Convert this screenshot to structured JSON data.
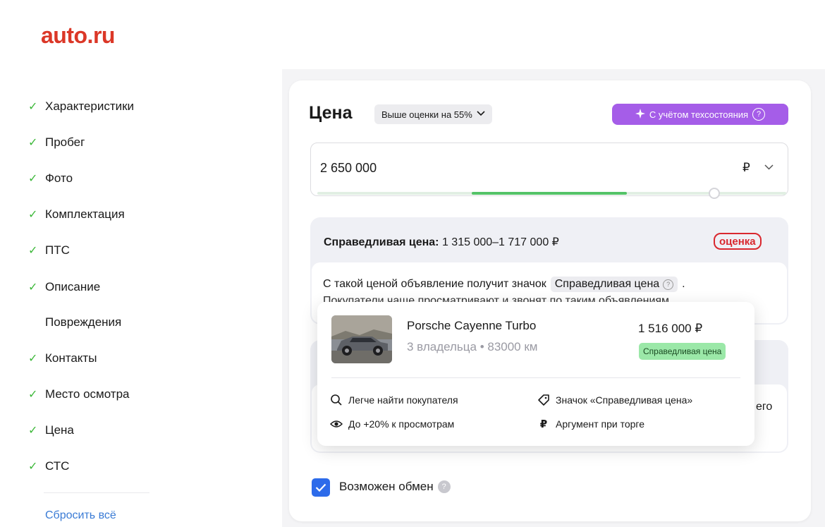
{
  "header": {
    "logo": "auto.ru"
  },
  "sidebar": {
    "items": [
      {
        "label": "Характеристики",
        "checked": true
      },
      {
        "label": "Пробег",
        "checked": true
      },
      {
        "label": "Фото",
        "checked": true
      },
      {
        "label": "Комплектация",
        "checked": true
      },
      {
        "label": "ПТС",
        "checked": true
      },
      {
        "label": "Описание",
        "checked": true
      },
      {
        "label": "Повреждения",
        "checked": false
      },
      {
        "label": "Контакты",
        "checked": true
      },
      {
        "label": "Место осмотра",
        "checked": true
      },
      {
        "label": "Цена",
        "checked": true
      },
      {
        "label": "СТС",
        "checked": true
      }
    ],
    "reset_label": "Сбросить всё"
  },
  "price": {
    "title": "Цена",
    "estimate_pill": "Выше оценки на 55%",
    "tech_button": "С учётом техсостояния",
    "value": "2 650 000",
    "currency": "₽",
    "slider_green_range": [
      0.33,
      0.66
    ],
    "slider_level": 0.84
  },
  "fair": {
    "title_bold": "Справедливая цена:",
    "title_range": "1 315 000–1 717 000 ₽",
    "ocenka_label": "оценка",
    "text_before": "С такой ценой объявление получит значок",
    "chip_label": "Справедливая цена",
    "text_after": ".",
    "text_line2": "Покупатели чаще просматривают и звонят по таким объявлениям"
  },
  "second": {
    "cut_text": "его"
  },
  "popup": {
    "car_name": "Porsche Cayenne Turbo",
    "car_meta": "3 владельца • 83000 км",
    "car_price": "1 516 000 ₽",
    "car_badge": "Справедливая цена",
    "benefits": [
      {
        "icon": "search-icon",
        "label": "Легче найти покупателя"
      },
      {
        "icon": "tag-icon",
        "label": "Значок «Справедливая цена»"
      },
      {
        "icon": "eye-icon",
        "label": "До +20% к просмотрам"
      },
      {
        "icon": "ruble-icon",
        "label": "Аргумент при торге"
      }
    ]
  },
  "exchange": {
    "label": "Возможен обмен",
    "checked": true
  },
  "colors": {
    "brand": "#db3727",
    "check": "#3db83a",
    "purple": "#a55de8",
    "green_badge": "#9be8a8",
    "checkbox_blue": "#2d6bea"
  }
}
